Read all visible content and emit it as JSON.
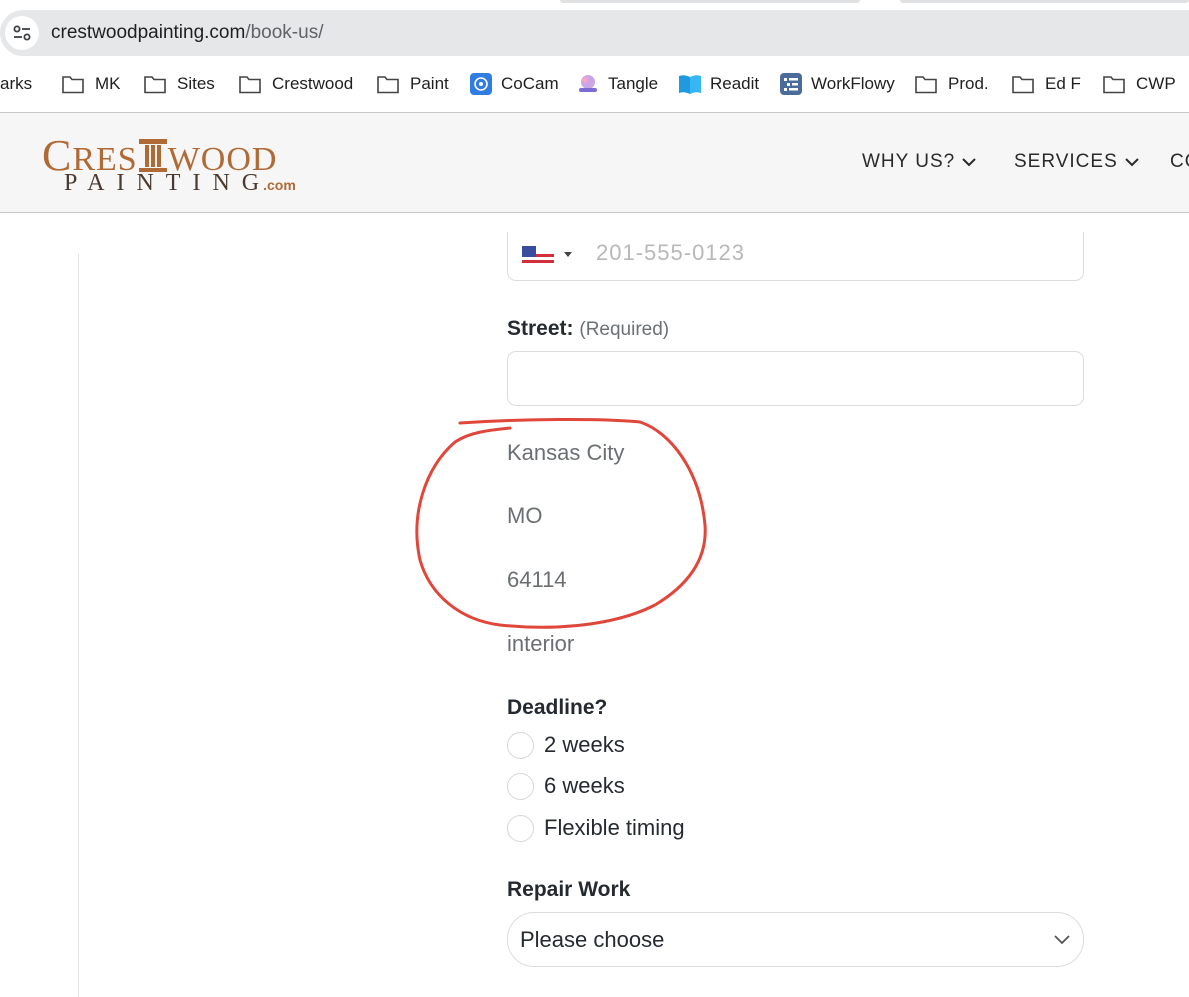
{
  "browser": {
    "url_domain": "crestwoodpainting.com",
    "url_path": "/book-us/",
    "bookmarks": [
      {
        "label": "arks",
        "icon": "folder-icon"
      },
      {
        "label": "MK",
        "icon": "folder-icon"
      },
      {
        "label": "Sites",
        "icon": "folder-icon"
      },
      {
        "label": "Crestwood",
        "icon": "folder-icon"
      },
      {
        "label": "Paint",
        "icon": "folder-icon"
      },
      {
        "label": "CoCam",
        "icon": "cocam-icon"
      },
      {
        "label": "Tangle",
        "icon": "tangle-icon"
      },
      {
        "label": "Readit",
        "icon": "book-icon"
      },
      {
        "label": "WorkFlowy",
        "icon": "workflowy-icon"
      },
      {
        "label": "Prod.",
        "icon": "folder-icon"
      },
      {
        "label": "Ed F",
        "icon": "folder-icon"
      },
      {
        "label": "CWP",
        "icon": "folder-icon"
      }
    ]
  },
  "site": {
    "logo": {
      "line1_a": "C",
      "line1_b": "RES",
      "line1_c": "WOOD",
      "line2": "PAINTING",
      "dotcom": ".com"
    },
    "nav": [
      {
        "label": "WHY US?"
      },
      {
        "label": "SERVICES"
      },
      {
        "label": "CO"
      }
    ],
    "brand_color": "#b06a35"
  },
  "form": {
    "phone_placeholder": "201-555-0123",
    "street": {
      "label": "Street:",
      "required": "(Required)",
      "value": ""
    },
    "city": "Kansas City",
    "state": "MO",
    "zip": "64114",
    "project_type": "interior",
    "deadline": {
      "label": "Deadline?",
      "options": [
        "2 weeks",
        "6 weeks",
        "Flexible timing"
      ]
    },
    "repair": {
      "label": "Repair Work",
      "selected": "Please choose"
    }
  },
  "annotation_color": "#e0463a"
}
